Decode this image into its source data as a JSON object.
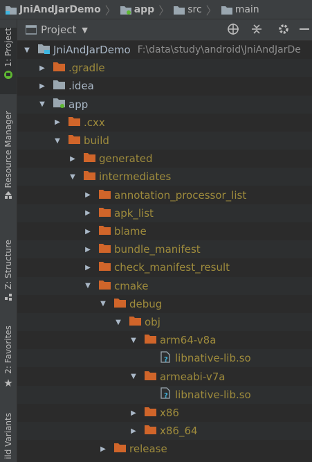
{
  "breadcrumb": {
    "items": [
      "JniAndJarDemo",
      "app",
      "src",
      "main"
    ]
  },
  "toolstrip": {
    "tabs": [
      "1: Project",
      "Resource Manager",
      "Z: Structure",
      "2: Favorites",
      "ild Variants"
    ]
  },
  "panel": {
    "title": "Project",
    "icons": [
      "crosshair-icon",
      "collapse-all-icon",
      "gear-icon",
      "minimize-icon"
    ]
  },
  "tree": {
    "root_name": "JniAndJarDemo",
    "root_path": "F:\\data\\study\\android\\JniAndJarDe",
    "items": [
      {
        "label": "JniAndJarDemo",
        "depth": 0,
        "expanded": true,
        "type": "module"
      },
      {
        "label": ".gradle",
        "depth": 1,
        "expanded": false,
        "type": "folder-orange",
        "excluded": true
      },
      {
        "label": ".idea",
        "depth": 1,
        "expanded": false,
        "type": "folder-gray",
        "excluded": false
      },
      {
        "label": "app",
        "depth": 1,
        "expanded": true,
        "type": "module",
        "excluded": false
      },
      {
        "label": ".cxx",
        "depth": 2,
        "expanded": false,
        "type": "folder-orange",
        "excluded": true
      },
      {
        "label": "build",
        "depth": 2,
        "expanded": true,
        "type": "folder-orange",
        "excluded": true
      },
      {
        "label": "generated",
        "depth": 3,
        "expanded": false,
        "type": "folder-orange",
        "excluded": true
      },
      {
        "label": "intermediates",
        "depth": 3,
        "expanded": true,
        "type": "folder-orange",
        "excluded": true
      },
      {
        "label": "annotation_processor_list",
        "depth": 4,
        "expanded": false,
        "type": "folder-orange",
        "excluded": true
      },
      {
        "label": "apk_list",
        "depth": 4,
        "expanded": false,
        "type": "folder-orange",
        "excluded": true
      },
      {
        "label": "blame",
        "depth": 4,
        "expanded": false,
        "type": "folder-orange",
        "excluded": true
      },
      {
        "label": "bundle_manifest",
        "depth": 4,
        "expanded": false,
        "type": "folder-orange",
        "excluded": true
      },
      {
        "label": "check_manifest_result",
        "depth": 4,
        "expanded": false,
        "type": "folder-orange",
        "excluded": true
      },
      {
        "label": "cmake",
        "depth": 4,
        "expanded": true,
        "type": "folder-orange",
        "excluded": true
      },
      {
        "label": "debug",
        "depth": 5,
        "expanded": true,
        "type": "folder-orange",
        "excluded": true
      },
      {
        "label": "obj",
        "depth": 6,
        "expanded": true,
        "type": "folder-orange",
        "excluded": true
      },
      {
        "label": "arm64-v8a",
        "depth": 7,
        "expanded": true,
        "type": "folder-orange",
        "excluded": true
      },
      {
        "label": "libnative-lib.so",
        "depth": 8,
        "expanded": null,
        "type": "file-unknown",
        "excluded": true
      },
      {
        "label": "armeabi-v7a",
        "depth": 7,
        "expanded": true,
        "type": "folder-orange",
        "excluded": true
      },
      {
        "label": "libnative-lib.so",
        "depth": 8,
        "expanded": null,
        "type": "file-unknown",
        "excluded": true
      },
      {
        "label": "x86",
        "depth": 7,
        "expanded": false,
        "type": "folder-orange",
        "excluded": true
      },
      {
        "label": "x86_64",
        "depth": 7,
        "expanded": false,
        "type": "folder-orange",
        "excluded": true
      },
      {
        "label": "release",
        "depth": 5,
        "expanded": false,
        "type": "folder-orange",
        "excluded": true
      }
    ]
  },
  "colors": {
    "background": "#2b2b2b",
    "panel": "#3c3f41",
    "text": "#a9b7c6",
    "excluded_text": "#9e8b3c",
    "folder_orange": "#d0652a",
    "folder_gray": "#9aa7b0"
  }
}
